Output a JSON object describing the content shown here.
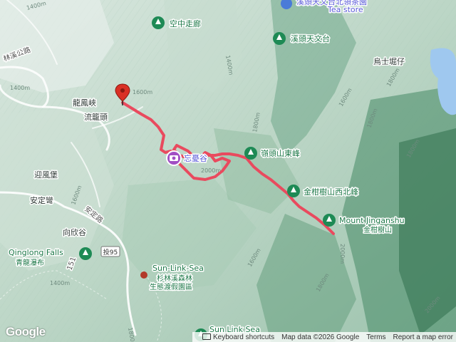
{
  "labels": {
    "tea_store": "Tea store",
    "top_partial": "溪頭天文台北領茶園",
    "sky_walk": "空中走廊",
    "observatory": "溪頭天文台",
    "wushi": "烏士堀仔",
    "linxi_road": "林溪公路",
    "longfengxia": "龍鳳峽",
    "liulongtou": "流籠頭",
    "xitou_east": "嶺頭山東峰",
    "jingan_nw": "金柑樹山西北峰",
    "jinganshu_en": "Mount Jinganshu",
    "jinganshu_zh": "金柑樹山",
    "yingfengbao": "迎風堡",
    "andingwan": "安定彎",
    "anding_road": "安定路",
    "xiangxingu": "向欣谷",
    "qinglong_en": "Qinglong Falls",
    "qinglong_zh": "青龍瀑布",
    "route_badge": "投95",
    "sunlink_en": "Sun-Link-Sea",
    "sunlink_zh1": "杉林溪森林",
    "sunlink_zh2": "生態渡假園區",
    "sunlink_bottom": "Sun Link Sea",
    "road_num": "151",
    "contours": [
      "1400m",
      "1600m",
      "1800m",
      "2000m",
      "1600m",
      "1800m",
      "1400m",
      "1800m",
      "2000m",
      "1400m",
      "1600m",
      "1400m",
      "1800m",
      "2000m",
      "1800m",
      "1600m",
      "1800m"
    ]
  },
  "footer": {
    "shortcuts": "Keyboard shortcuts",
    "map_data": "Map data ©2026 Google",
    "terms": "Terms",
    "report": "Report a map error"
  },
  "logo": "Google",
  "colors": {
    "route": "#e94a5e",
    "park_icon": "#1e8a55",
    "water": "#9fc8ef",
    "marker": "#d93025"
  }
}
